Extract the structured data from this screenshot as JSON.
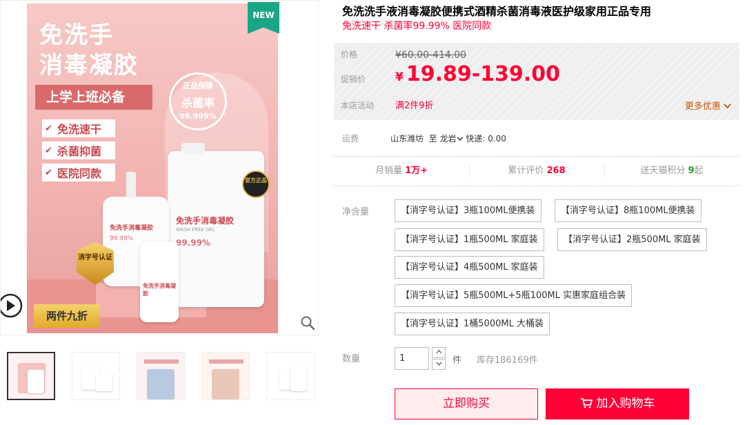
{
  "poster": {
    "title_line1": "免洗手",
    "title_line2": "消毒凝胶",
    "banner": "上学上班必备",
    "features": [
      "免洗速干",
      "杀菌抑菌",
      "医院同款"
    ],
    "seal_top": "正品保障",
    "seal_mid": "杀菌率",
    "seal_bottom": "99.999%",
    "bottle_label": "免洗手消毒凝胶",
    "bottle_label_en": "WASH FREE GEL",
    "bottle_rate": "99.99%",
    "cert_badge": "消字号认证",
    "official_badge": "官方正品",
    "promo": "两件九折",
    "new_tag": "NEW"
  },
  "thumbnails": [
    "thumb-1",
    "thumb-2",
    "thumb-3",
    "thumb-4",
    "thumb-5"
  ],
  "product": {
    "title": "免洗洗手液消毒凝胶便携式酒精杀菌消毒液医护级家用正品专用",
    "subtitle": "免洗速干 杀菌率99.99% 医院同款"
  },
  "price": {
    "orig_label": "价格",
    "orig_value": "¥60.00-414.00",
    "promo_label": "促销价",
    "currency": "¥",
    "promo_value": "19.89-139.00",
    "activity_label": "本店活动",
    "activity_value": "满2件9折",
    "more_deals": "更多优惠"
  },
  "shipping": {
    "label": "运费",
    "from": "山东潍坊",
    "to_prefix": "至",
    "to": "龙岩",
    "fee": "快递: 0.00"
  },
  "stats": {
    "monthly_label": "月销量",
    "monthly_value": "1万+",
    "reviews_label": "累计评价",
    "reviews_value": "268",
    "points_label": "送天猫积分",
    "points_value": "9",
    "points_suffix": "起"
  },
  "specs": {
    "label": "净含量",
    "options": [
      "【消字号认证】3瓶100ML便携装",
      "【消字号认证】8瓶100ML便携装",
      "【消字号认证】1瓶500ML 家庭装",
      "【消字号认证】2瓶500ML 家庭装",
      "【消字号认证】4瓶500ML 家庭装",
      "【消字号认证】5瓶500ML+5瓶100ML 实惠家庭组合装",
      "【消字号认证】1桶5000ML 大桶装"
    ]
  },
  "quantity": {
    "label": "数量",
    "value": "1",
    "unit": "件",
    "stock": "库存186169件"
  },
  "actions": {
    "buy_now": "立即购买",
    "add_to_cart": "加入购物车"
  },
  "colors": {
    "accent": "#ff0036",
    "new_tag": "#1aa686"
  }
}
